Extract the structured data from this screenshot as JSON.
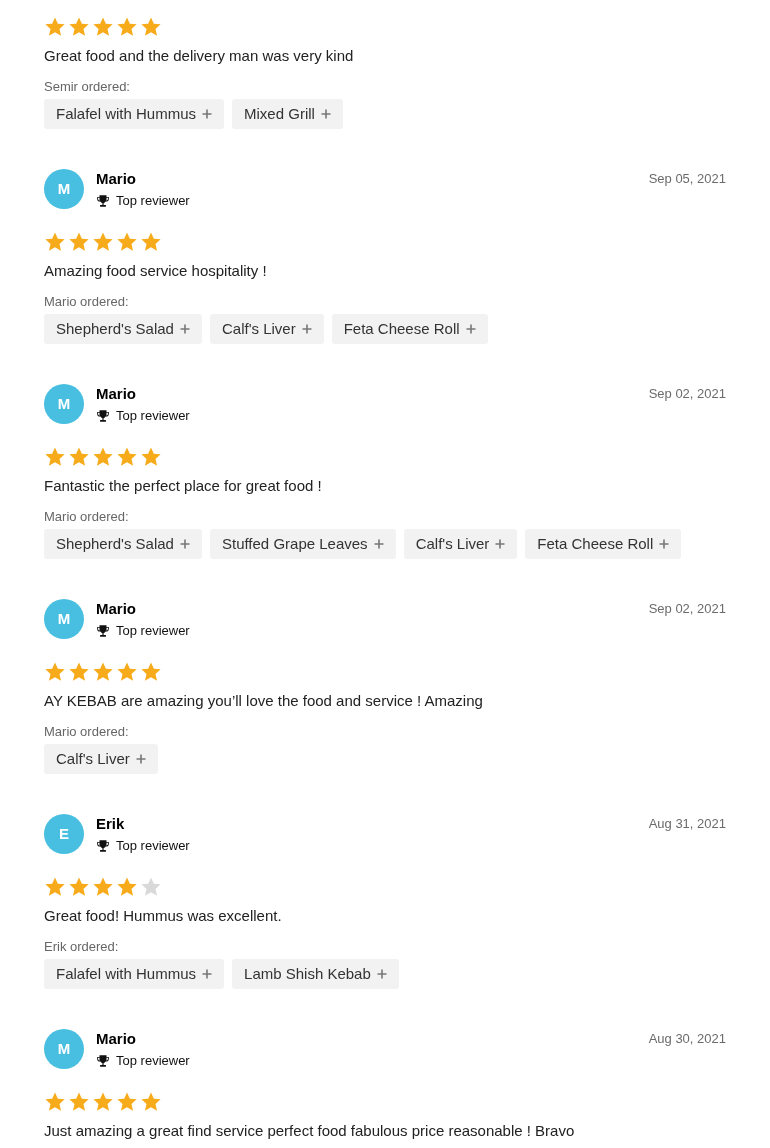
{
  "reviews": [
    {
      "stars": 5,
      "text": "Great food and the delivery man was very kind",
      "ordered_label": "Semir ordered:",
      "items": [
        "Falafel with Hummus",
        "Mixed Grill"
      ]
    },
    {
      "initial": "M",
      "name": "Mario",
      "badge": "Top reviewer",
      "date": "Sep 05, 2021",
      "stars": 5,
      "text": "Amazing food service hospitality !",
      "ordered_label": "Mario ordered:",
      "items": [
        "Shepherd's Salad",
        "Calf's Liver",
        "Feta Cheese Roll"
      ]
    },
    {
      "initial": "M",
      "name": "Mario",
      "badge": "Top reviewer",
      "date": "Sep 02, 2021",
      "stars": 5,
      "text": "Fantastic the perfect place for great food !",
      "ordered_label": "Mario ordered:",
      "items": [
        "Shepherd's Salad",
        "Stuffed Grape Leaves",
        "Calf's Liver",
        "Feta Cheese Roll"
      ]
    },
    {
      "initial": "M",
      "name": "Mario",
      "badge": "Top reviewer",
      "date": "Sep 02, 2021",
      "stars": 5,
      "text": "AY KEBAB are amazing you’ll love the food and service ! Amazing",
      "ordered_label": "Mario ordered:",
      "items": [
        "Calf's Liver"
      ]
    },
    {
      "initial": "E",
      "name": "Erik",
      "badge": "Top reviewer",
      "date": "Aug 31, 2021",
      "stars": 4,
      "text": "Great food! Hummus was excellent.",
      "ordered_label": "Erik ordered:",
      "items": [
        "Falafel with Hummus",
        "Lamb Shish Kebab"
      ]
    },
    {
      "initial": "M",
      "name": "Mario",
      "badge": "Top reviewer",
      "date": "Aug 30, 2021",
      "stars": 5,
      "text": "Just amazing a great find service perfect food fabulous price reasonable ! Bravo"
    }
  ]
}
